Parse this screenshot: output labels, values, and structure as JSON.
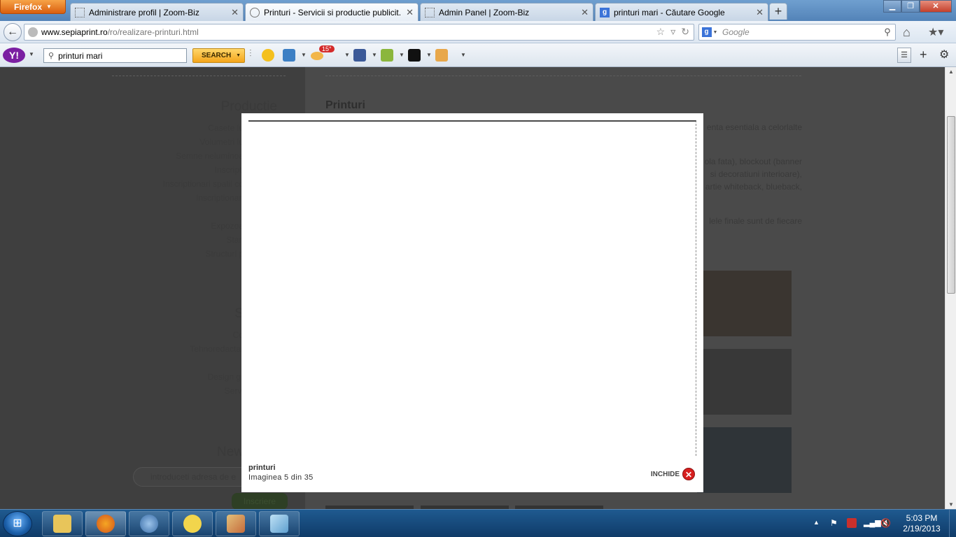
{
  "browser": {
    "menu_button_label": "Firefox",
    "tabs": [
      {
        "label": "Administrare profil | Zoom-Biz",
        "active": false
      },
      {
        "label": "Printuri - Servicii si productie publicit...",
        "active": true
      },
      {
        "label": "Admin Panel | Zoom-Biz",
        "active": false
      },
      {
        "label": "printuri mari - Căutare Google",
        "active": false
      }
    ],
    "url_domain": "www.sepiaprint.ro",
    "url_path": "/ro/realizare-printuri.html",
    "search_placeholder": "Google",
    "search_engine_letter": "g"
  },
  "yahoo_toolbar": {
    "logo_text": "Y!",
    "search_value": "printuri mari",
    "search_button_label": "SEARCH",
    "weather_badge": "15°"
  },
  "page": {
    "sidebar_heading": "Productie",
    "sidebar_links": [
      "Casete lu",
      "Volumetri lu",
      "Semne neluminoa",
      "Inscripti",
      "Inscriptionari spatii co",
      "Inscriptionari",
      "Expozoa",
      "Stan",
      "Structuri p"
    ],
    "sidebar_heading2": "S",
    "sidebar_links2": [
      "Co",
      "Tehnoredactar",
      "Design gr",
      "Servi"
    ],
    "newsletter_heading": "New",
    "newsletter_placeholder": "introduceti adresa de e",
    "newsletter_button": "Inscriere",
    "main_title": "Printuri",
    "main_text_fragments": [
      "enta esentiala a celorlalte",
      "ola fata), blockout (banner",
      "si decoratiuni interioare),",
      "artie whiteback, blueback,",
      "lele finale sunt de fiecare"
    ]
  },
  "lightbox": {
    "caption_title": "printuri",
    "caption_count": "Imaginea 5 din 35",
    "close_label": "INCHIDE"
  },
  "taskbar": {
    "time": "5:03 PM",
    "date": "2/19/2013"
  }
}
